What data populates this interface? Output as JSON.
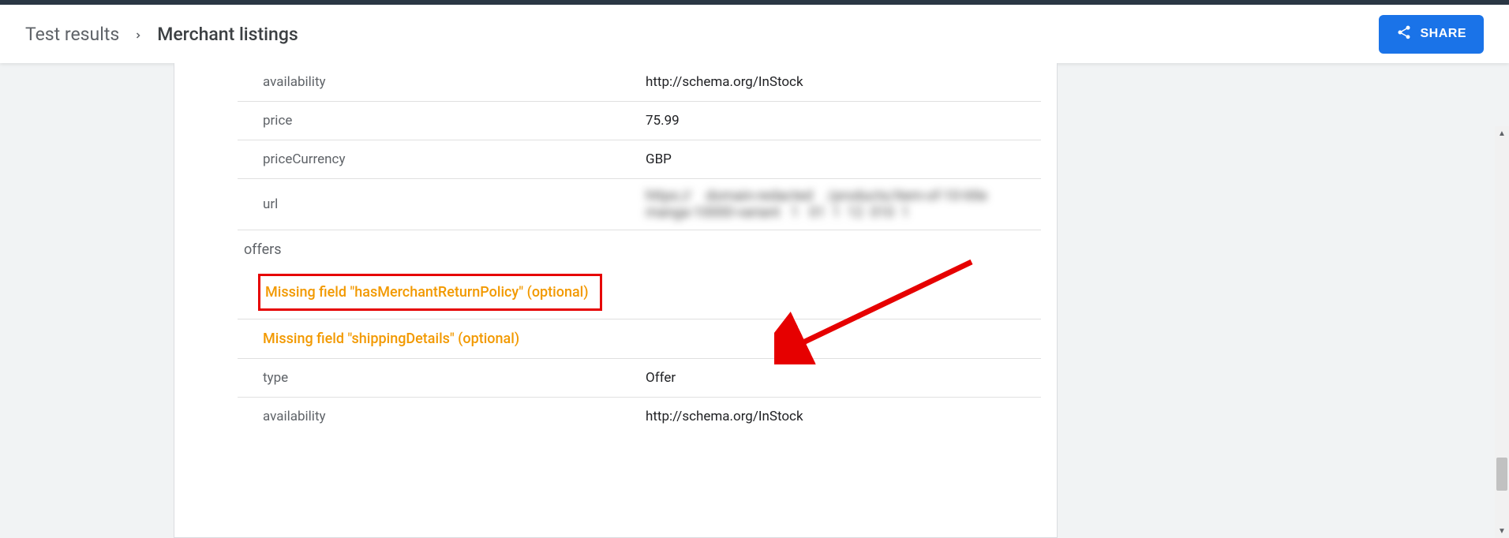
{
  "header": {
    "breadcrumb_root": "Test results",
    "breadcrumb_current": "Merchant listings",
    "share_label": "SHARE"
  },
  "block1": {
    "rows": [
      {
        "key": "availability",
        "value": "http://schema.org/InStock"
      },
      {
        "key": "price",
        "value": "75.99"
      },
      {
        "key": "priceCurrency",
        "value": "GBP"
      },
      {
        "key": "url",
        "value": ""
      }
    ]
  },
  "section_title": "offers",
  "warnings": [
    "Missing field \"hasMerchantReturnPolicy\" (optional)",
    "Missing field \"shippingDetails\" (optional)"
  ],
  "block2": {
    "rows": [
      {
        "key": "type",
        "value": "Offer"
      },
      {
        "key": "availability",
        "value": "http://schema.org/InStock"
      }
    ]
  }
}
